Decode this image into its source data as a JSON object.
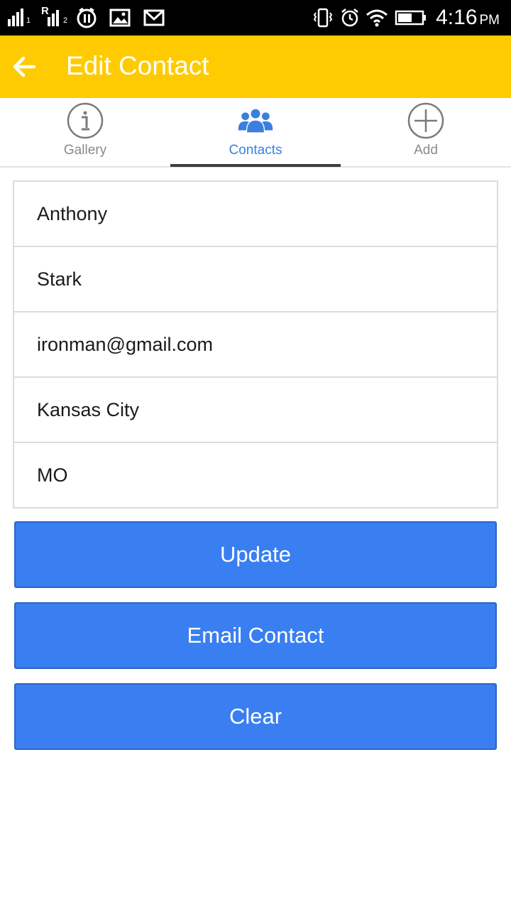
{
  "status_bar": {
    "sim1_label": "1",
    "sim2_label": "2",
    "roaming_label": "R",
    "time": "4:16",
    "ampm": "PM",
    "icons": [
      "signal-sim1-icon",
      "signal-sim2-icon",
      "sync-icon",
      "image-icon",
      "gmail-icon",
      "vibrate-icon",
      "alarm-icon",
      "wifi-icon",
      "battery-icon"
    ]
  },
  "app_bar": {
    "title": "Edit Contact",
    "background": "#fecb00",
    "back_icon": "arrow-back-icon"
  },
  "tabs": [
    {
      "label": "Gallery",
      "icon": "info-circle-icon",
      "active": false
    },
    {
      "label": "Contacts",
      "icon": "people-group-icon",
      "active": true
    },
    {
      "label": "Add",
      "icon": "plus-circle-icon",
      "active": false
    }
  ],
  "form": {
    "first_name": "Anthony",
    "last_name": "Stark",
    "email": "ironman@gmail.com",
    "city": "Kansas City",
    "state": "MO"
  },
  "buttons": {
    "update": "Update",
    "email_contact": "Email Contact",
    "clear": "Clear"
  },
  "colors": {
    "accent": "#397ff1",
    "active_tab": "#3b7fe0",
    "app_bar": "#fecb00"
  }
}
